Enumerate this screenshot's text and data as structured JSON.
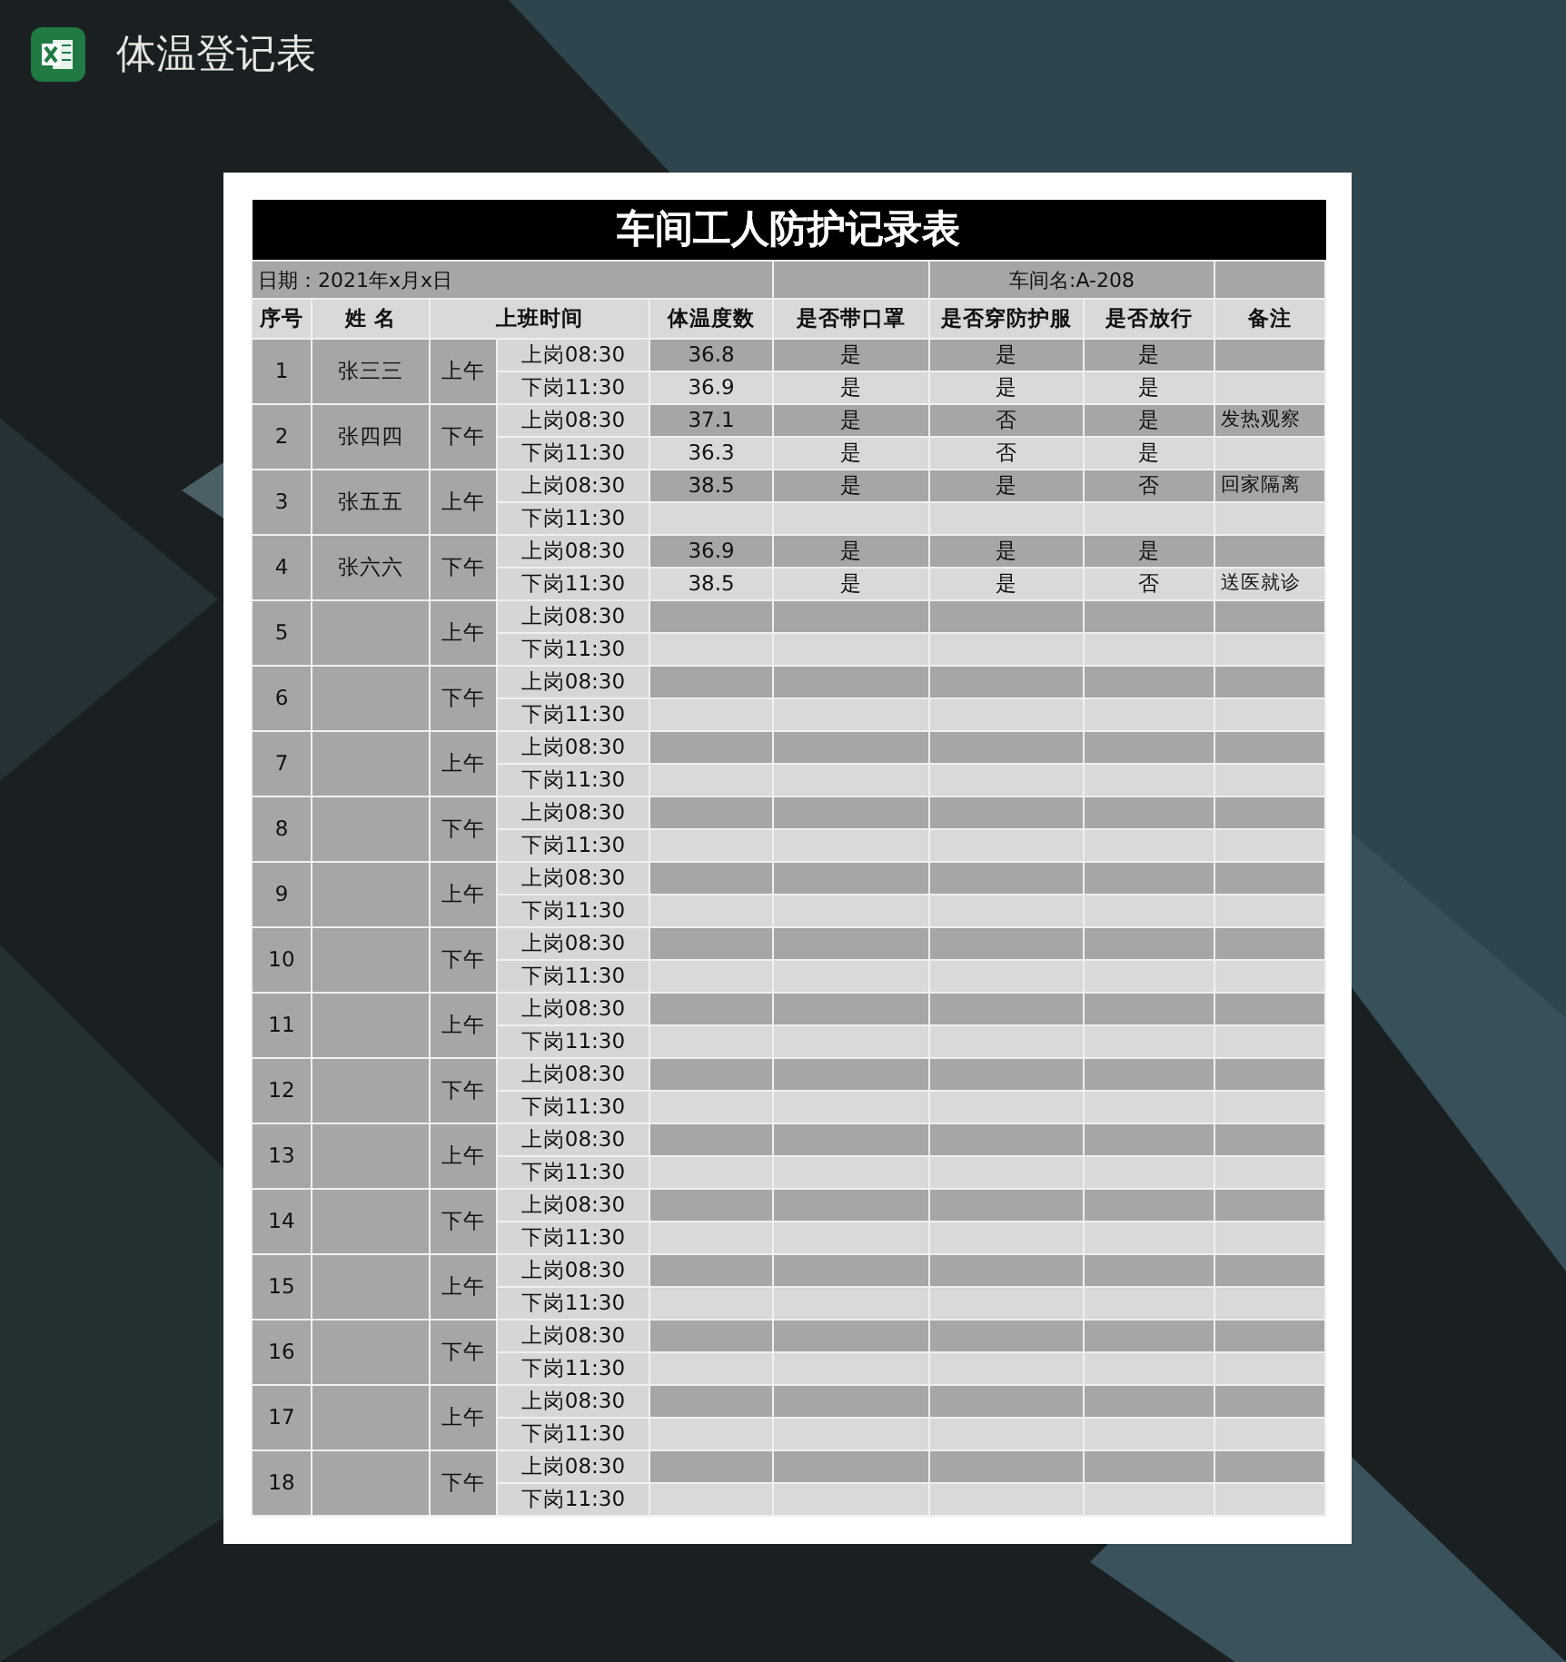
{
  "app": {
    "title": "体温登记表"
  },
  "sheet": {
    "title": "车间工人防护记录表",
    "date": "日期：2021年x月x日",
    "workshop": "车间名:A-208",
    "columns": [
      "序号",
      "姓 名",
      "上班时间",
      "体温度数",
      "是否带口罩",
      "是否穿防护服",
      "是否放行",
      "备注"
    ],
    "groups": [
      {
        "no": "1",
        "name": "张三三",
        "period": "上午",
        "rows": [
          {
            "time": "上岗08:30",
            "temp": "36.8",
            "mask": "是",
            "suit": "是",
            "pass": "是"
          },
          {
            "time": "下岗11:30",
            "temp": "36.9",
            "mask": "是",
            "suit": "是",
            "pass": "是"
          }
        ]
      },
      {
        "no": "2",
        "name": "张四四",
        "period": "下午",
        "rows": [
          {
            "time": "上岗08:30",
            "temp": "37.1",
            "mask": "是",
            "suit": "否",
            "pass": "是",
            "note": "发热观察"
          },
          {
            "time": "下岗11:30",
            "temp": "36.3",
            "mask": "是",
            "suit": "否",
            "pass": "是"
          }
        ]
      },
      {
        "no": "3",
        "name": "张五五",
        "period": "上午",
        "rows": [
          {
            "time": "上岗08:30",
            "temp": "38.5",
            "mask": "是",
            "suit": "是",
            "pass": "否",
            "note": "回家隔离"
          },
          {
            "time": "下岗11:30"
          }
        ]
      },
      {
        "no": "4",
        "name": "张六六",
        "period": "下午",
        "rows": [
          {
            "time": "上岗08:30",
            "temp": "36.9",
            "mask": "是",
            "suit": "是",
            "pass": "是"
          },
          {
            "time": "下岗11:30",
            "temp": "38.5",
            "mask": "是",
            "suit": "是",
            "pass": "否",
            "note": "送医就诊"
          }
        ]
      },
      {
        "no": "5",
        "period": "上午",
        "rows": [
          {
            "time": "上岗08:30"
          },
          {
            "time": "下岗11:30"
          }
        ]
      },
      {
        "no": "6",
        "period": "下午",
        "rows": [
          {
            "time": "上岗08:30"
          },
          {
            "time": "下岗11:30"
          }
        ]
      },
      {
        "no": "7",
        "period": "上午",
        "rows": [
          {
            "time": "上岗08:30"
          },
          {
            "time": "下岗11:30"
          }
        ]
      },
      {
        "no": "8",
        "period": "下午",
        "rows": [
          {
            "time": "上岗08:30"
          },
          {
            "time": "下岗11:30"
          }
        ]
      },
      {
        "no": "9",
        "period": "上午",
        "rows": [
          {
            "time": "上岗08:30"
          },
          {
            "time": "下岗11:30"
          }
        ]
      },
      {
        "no": "10",
        "period": "下午",
        "rows": [
          {
            "time": "上岗08:30"
          },
          {
            "time": "下岗11:30"
          }
        ]
      },
      {
        "no": "11",
        "period": "上午",
        "rows": [
          {
            "time": "上岗08:30"
          },
          {
            "time": "下岗11:30"
          }
        ]
      },
      {
        "no": "12",
        "period": "下午",
        "rows": [
          {
            "time": "上岗08:30"
          },
          {
            "time": "下岗11:30"
          }
        ]
      },
      {
        "no": "13",
        "period": "上午",
        "rows": [
          {
            "time": "上岗08:30"
          },
          {
            "time": "下岗11:30"
          }
        ]
      },
      {
        "no": "14",
        "period": "下午",
        "rows": [
          {
            "time": "上岗08:30"
          },
          {
            "time": "下岗11:30"
          }
        ]
      },
      {
        "no": "15",
        "period": "上午",
        "rows": [
          {
            "time": "上岗08:30"
          },
          {
            "time": "下岗11:30"
          }
        ]
      },
      {
        "no": "16",
        "period": "下午",
        "rows": [
          {
            "time": "上岗08:30"
          },
          {
            "time": "下岗11:30"
          }
        ]
      },
      {
        "no": "17",
        "period": "上午",
        "rows": [
          {
            "time": "上岗08:30"
          },
          {
            "time": "下岗11:30"
          }
        ]
      },
      {
        "no": "18",
        "period": "下午",
        "rows": [
          {
            "time": "上岗08:30"
          },
          {
            "time": "下岗11:30"
          }
        ]
      }
    ]
  }
}
